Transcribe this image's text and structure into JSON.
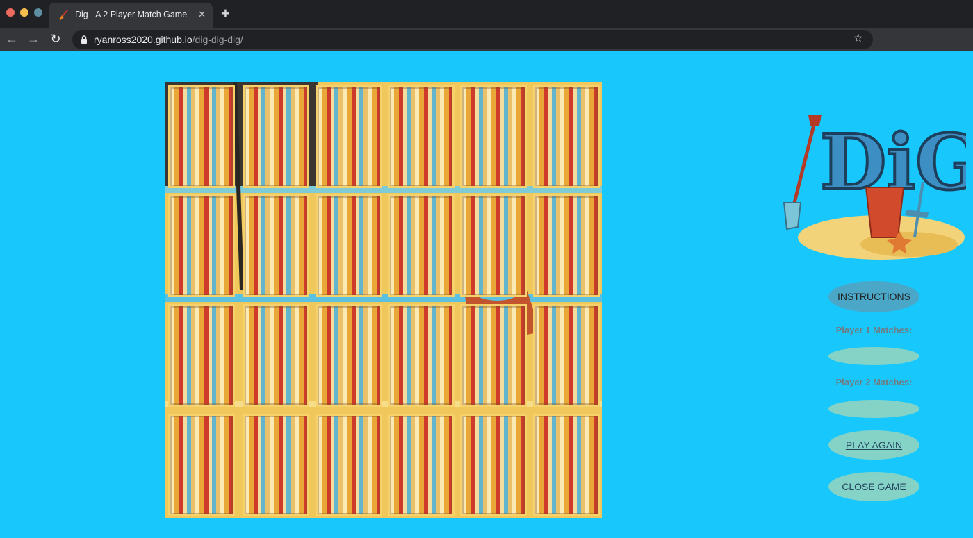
{
  "browser": {
    "tab_title": "Dig - A 2 Player Match Game",
    "tab_icon": "shovel-icon",
    "url_host": "ryanross2020.github.io",
    "url_path": "/dig-dig-dig/",
    "close_glyph": "✕",
    "new_tab_glyph": "+",
    "back_glyph": "←",
    "forward_glyph": "→",
    "reload_glyph": "↻",
    "star_glyph": "☆"
  },
  "game": {
    "logo_text": "DiG",
    "board": {
      "rows": 4,
      "cols": 6,
      "face_down_cards": 24
    },
    "instructions_label": "INSTRUCTIONS",
    "player1_label": "Player 1 Matches:",
    "player1_matches": "",
    "player2_label": "Player 2 Matches:",
    "player2_matches": "",
    "play_again_label": "PLAY AGAIN",
    "close_game_label": "CLOSE GAME"
  },
  "colors": {
    "page_background": "#18c8fd",
    "card_border": "#f7d26b",
    "stripe_red": "#ce3b2a",
    "stripe_orange": "#e9a737",
    "stripe_blue": "#63b5cd",
    "button_teal": "#85d3c7",
    "instructions_button": "#4aa7c7"
  }
}
